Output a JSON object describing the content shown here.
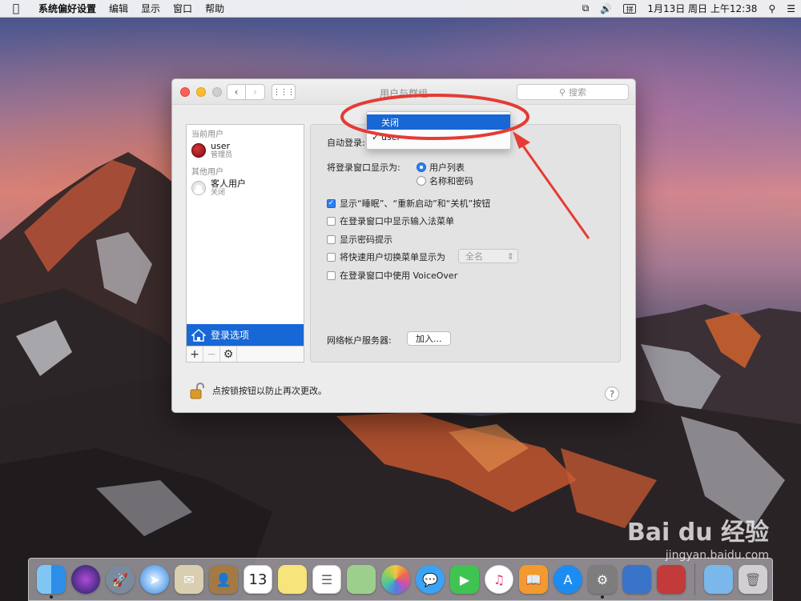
{
  "menubar": {
    "app_name": "系统偏好设置",
    "menus": [
      "编辑",
      "显示",
      "窗口",
      "帮助"
    ],
    "input_method": "拼",
    "clock": "1月13日 周日 上午12:38"
  },
  "window": {
    "title": "用户与群组",
    "search_placeholder": "搜索"
  },
  "sidebar": {
    "current_users_header": "当前用户",
    "current_user": {
      "name": "user",
      "role": "管理员"
    },
    "other_users_header": "其他用户",
    "guest_user": {
      "name": "客人用户",
      "status": "关闭"
    },
    "login_options_label": "登录选项",
    "add_label": "+",
    "remove_label": "−"
  },
  "login_options": {
    "auto_login_label": "自动登录:",
    "auto_login_value": "user",
    "display_as_label": "将登录窗口显示为:",
    "display_options": [
      {
        "label": "用户列表",
        "selected": true
      },
      {
        "label": "名称和密码",
        "selected": false
      }
    ],
    "checkboxes": [
      {
        "label": "显示“睡眠”、“重新启动”和“关机”按钮",
        "checked": true
      },
      {
        "label": "在登录窗口中显示输入法菜单",
        "checked": false
      },
      {
        "label": "显示密码提示",
        "checked": false
      },
      {
        "label": "将快速用户切换菜单显示为",
        "checked": false
      },
      {
        "label": "在登录窗口中使用 VoiceOver",
        "checked": false
      }
    ],
    "fast_switch_value": "全名",
    "network_server_label": "网络帐户服务器:",
    "join_button": "加入..."
  },
  "lock": {
    "text": "点按锁按钮以防止再次更改。"
  },
  "help": "?",
  "dropdown": {
    "items": [
      {
        "label": "关闭",
        "highlighted": true
      },
      {
        "label": "user",
        "checked": true
      }
    ]
  },
  "dock": {
    "calendar_day": "13",
    "apps": [
      "Finder",
      "Siri",
      "Launchpad",
      "Safari",
      "Mail",
      "Contacts",
      "Calendar",
      "Notes",
      "Reminders",
      "Maps",
      "Photos",
      "Messages",
      "FaceTime",
      "iTunes",
      "iBooks",
      "App Store",
      "System Preferences",
      "Downloads",
      "Trash"
    ]
  },
  "watermark": {
    "brand": "Bai du 经验",
    "url": "jingyan.baidu.com"
  },
  "colors": {
    "accent": "#1767d6",
    "annotation": "#e53b34"
  }
}
